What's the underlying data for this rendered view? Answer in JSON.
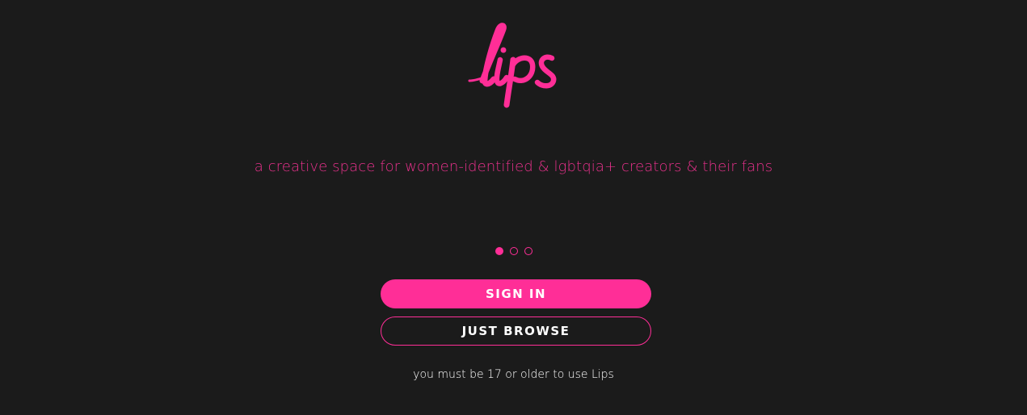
{
  "brand": {
    "logo_text": "lips",
    "accent_color": "#ff2e97",
    "background_color": "#1b1b1b"
  },
  "tagline": "a creative space for women-identified & lgbtqia+ creators & their fans",
  "carousel": {
    "slide_count": 3,
    "active_index": 0
  },
  "actions": {
    "sign_in_label": "SIGN IN",
    "browse_label": "JUST BROWSE"
  },
  "age_notice": "you must be 17 or older to use Lips"
}
